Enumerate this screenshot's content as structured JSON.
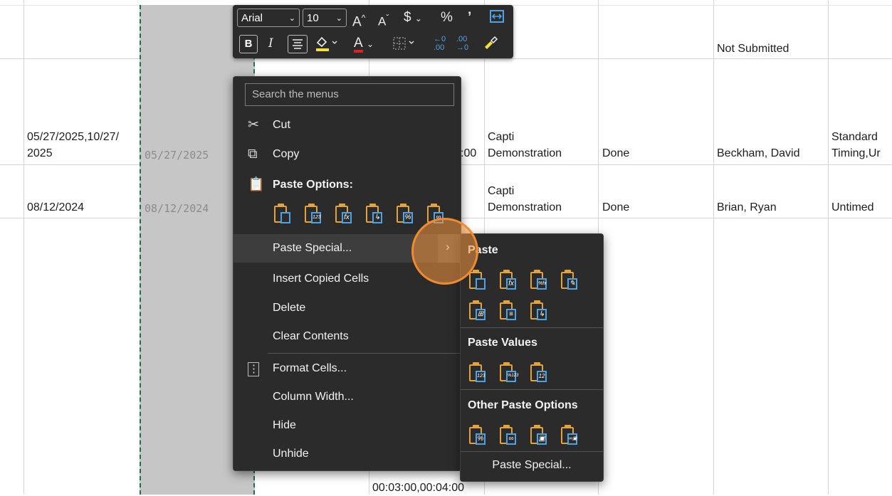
{
  "sheet": {
    "row1": {
      "status": "Not Submitted"
    },
    "row2": {
      "dates": "05/27/2025,10/27/\n2025",
      "dates_line1": "05/27/2025,10/27/",
      "dates_line2": "2025",
      "ghost": "05/27/2025",
      "time_tail": ":00",
      "title1": "Capti",
      "title2": "Demonstration",
      "state": "Done",
      "name": "Beckham, David",
      "timing1": "Standard",
      "timing2": "Timing,Ur"
    },
    "row3": {
      "dates": "08/12/2024",
      "ghost": "08/12/2024",
      "title1": "Capti",
      "title2": "Demonstration",
      "state": "Done",
      "name": "Brian, Ryan",
      "timing": "Untimed"
    },
    "bottom_time": "00:03:00,00:04:00"
  },
  "mini_toolbar": {
    "font": "Arial",
    "size": "10",
    "grow": "A",
    "shrink": "A",
    "currency": "$",
    "percent": "%",
    "comma": "’",
    "bold": "B",
    "italic": "I",
    "font_color": "A",
    "inc_decimal": ".00",
    "dec_decimal": ".00"
  },
  "context_menu": {
    "search_placeholder": "Search the menus",
    "items": {
      "cut": "Cut",
      "copy": "Copy",
      "paste_options": "Paste Options:",
      "paste_special": "Paste Special...",
      "insert_copied": "Insert Copied Cells",
      "delete": "Delete",
      "clear_contents": "Clear Contents",
      "format_cells": "Format Cells...",
      "column_width": "Column Width...",
      "hide": "Hide",
      "unhide": "Unhide"
    },
    "paste_icons": [
      "paste-icon",
      "paste-values-icon",
      "paste-formulas-icon",
      "paste-transpose-icon",
      "paste-formatting-icon",
      "paste-link-icon"
    ],
    "paste_icon_glyphs": [
      "",
      "123",
      "fx",
      "↳",
      "%",
      "∞"
    ]
  },
  "submenu": {
    "paste_header": "Paste",
    "paste_values_header": "Paste Values",
    "other_header": "Other Paste Options",
    "paste_special": "Paste Special...",
    "paste_row1_glyphs": [
      "",
      "fx",
      "%fx",
      "✎"
    ],
    "paste_row2_glyphs": [
      "⊞",
      "≡",
      "↳"
    ],
    "values_glyphs": [
      "123",
      "%123",
      "12"
    ],
    "other_glyphs": [
      "%",
      "∞",
      "▣",
      "∞▣"
    ]
  },
  "colors": {
    "accent_orange": "#f08a2e",
    "copy_border": "#1e7145",
    "menu_bg": "#2b2b2b"
  }
}
